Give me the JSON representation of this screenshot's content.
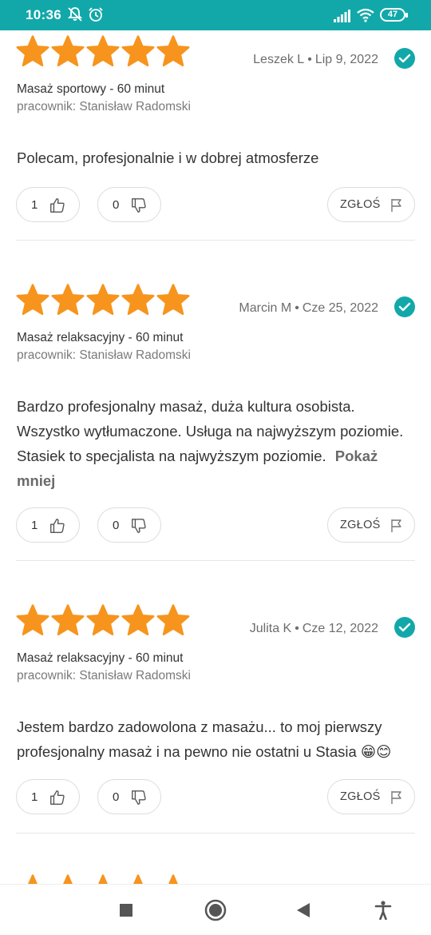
{
  "status_bar": {
    "time": "10:36",
    "battery": "47",
    "icons": [
      "mute-icon",
      "alarm-icon",
      "signal-icon",
      "wifi-icon",
      "battery-icon"
    ]
  },
  "colors": {
    "accent": "#12a8a9",
    "star": "#f7941d"
  },
  "reviews": [
    {
      "rating": 5,
      "author": "Leszek L",
      "date": "Lip 9, 2022",
      "service": "Masaż sportowy - 60 minut",
      "worker": "pracownik: Stanisław Radomski",
      "text": "Polecam, profesjonalnie i w dobrej atmosferze",
      "likes": "1",
      "dislikes": "0",
      "report_label": "ZGŁOŚ"
    },
    {
      "rating": 5,
      "author": "Marcin M",
      "date": "Cze 25, 2022",
      "service": "Masaż relaksacyjny - 60 minut",
      "worker": "pracownik: Stanisław Radomski",
      "text": "Bardzo profesjonalny masaż, duża kultura osobista. Wszystko wytłumaczone. Usługa na najwyższym poziomie. Stasiek to specjalista na najwyższym poziomie.",
      "show_less": "Pokaż mniej",
      "likes": "1",
      "dislikes": "0",
      "report_label": "ZGŁOŚ"
    },
    {
      "rating": 5,
      "author": "Julita K",
      "date": "Cze 12, 2022",
      "service": "Masaż relaksacyjny - 60 minut",
      "worker": "pracownik: Stanisław Radomski",
      "text": "Jestem bardzo zadowolona z masażu... to moj pierwszy profesjonalny masaż i na pewno nie ostatni u Stasia 😁😊",
      "likes": "1",
      "dislikes": "0",
      "report_label": "ZGŁOŚ"
    }
  ],
  "nav_bar": {
    "buttons": [
      "recents-button",
      "home-button",
      "back-button",
      "accessibility-button"
    ]
  }
}
